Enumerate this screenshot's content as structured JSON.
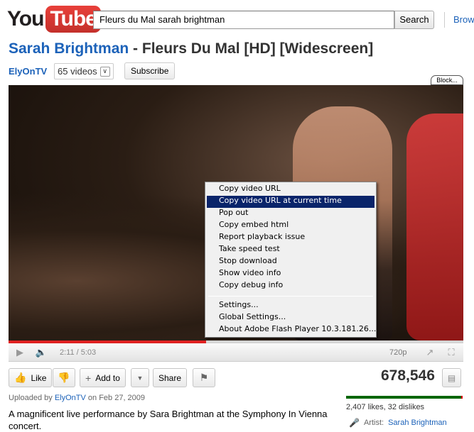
{
  "header": {
    "logo_you": "You",
    "logo_tube": "Tube",
    "search_value": "Fleurs du Mal sarah brightman",
    "search_button": "Search",
    "browse_link": "Browse"
  },
  "video": {
    "title_artist": "Sarah Brightman",
    "title_rest": " - Fleurs Du Mal [HD] [Widescreen]",
    "channel_name": "ElyOnTV",
    "videos_count": "65 videos",
    "subscribe": "Subscribe",
    "block_tag": "Block..."
  },
  "context_menu": {
    "items": [
      "Copy video URL",
      "Copy video URL at current time",
      "Pop out",
      "Copy embed html",
      "Report playback issue",
      "Take speed test",
      "Stop download",
      "Show video info",
      "Copy debug info"
    ],
    "highlighted_index": 1,
    "settings": "Settings...",
    "global_settings": "Global Settings...",
    "about": "About Adobe Flash Player 10.3.181.26..."
  },
  "player": {
    "time": "2:11 / 5:03",
    "quality": "720p",
    "progress_fraction": 0.435
  },
  "actions": {
    "like": "Like",
    "add_to": "Add to",
    "share": "Share",
    "view_count": "678,546"
  },
  "meta": {
    "uploaded_prefix": "Uploaded by ",
    "uploader": "ElyOnTV",
    "uploaded_date": " on Feb 27, 2009",
    "description": "A magnificent live performance by Sara Brightman at the Symphony In Vienna concert.",
    "likes_text": "2,407 likes, 32 dislikes",
    "like_fraction": 0.987,
    "artist_label": "Artist:",
    "artist_name": "Sarah Brightman"
  },
  "colors": {
    "link_blue": "#1c62b9",
    "progress_red": "#e02222",
    "menu_highlight": "#0a246a",
    "likes_green": "#006600"
  }
}
